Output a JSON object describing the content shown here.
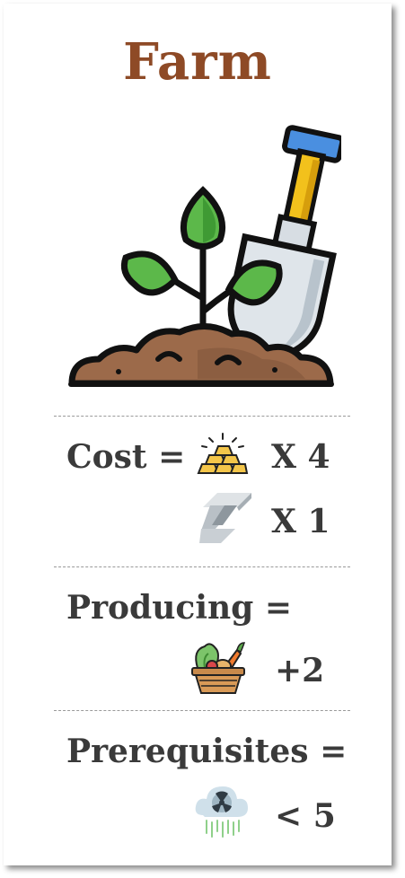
{
  "card": {
    "title": "Farm",
    "title_color": "#8e4a26",
    "hero_icon": "plant-with-shovel-icon"
  },
  "cost": {
    "label": "Cost =",
    "items": [
      {
        "icon": "gold-bars-icon",
        "amount": "X 4"
      },
      {
        "icon": "steel-beam-icon",
        "amount": "X 1"
      }
    ]
  },
  "producing": {
    "label": "Producing =",
    "items": [
      {
        "icon": "vegetable-basket-icon",
        "amount": "+2"
      }
    ]
  },
  "prerequisites": {
    "label": "Prerequisites =",
    "items": [
      {
        "icon": "radioactive-rain-cloud-icon",
        "amount": "< 5"
      }
    ]
  }
}
